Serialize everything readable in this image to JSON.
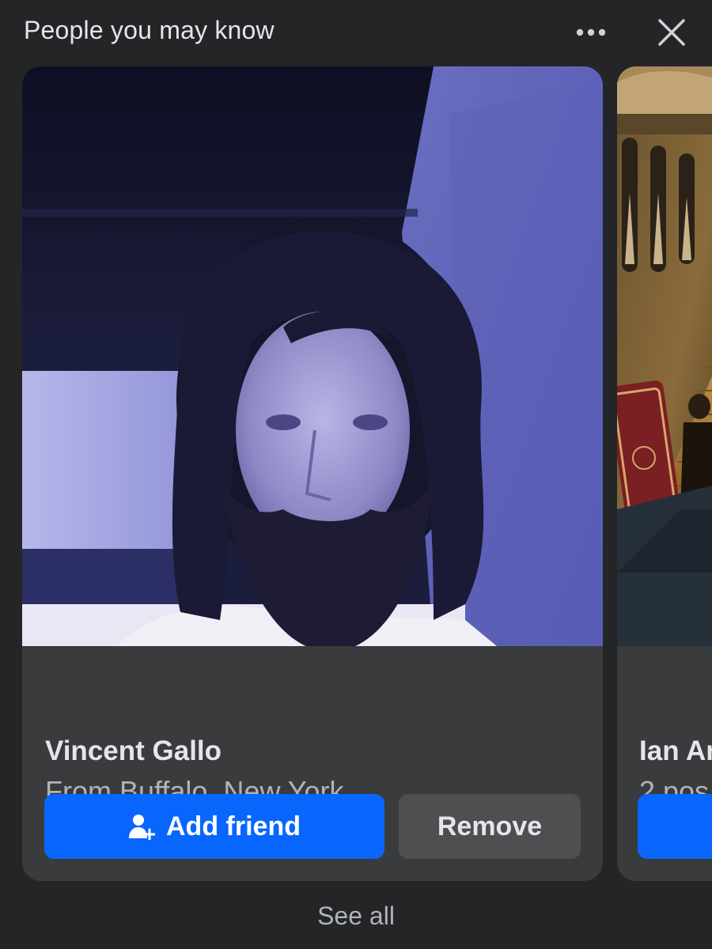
{
  "header": {
    "title": "People you may know",
    "more_icon": "more-horizontal-icon",
    "close_icon": "close-icon"
  },
  "suggestions": [
    {
      "name": "Vincent Gallo",
      "subtitle": "From Buffalo, New York",
      "photo": "profile-photo-bearded-man",
      "add_label": "Add friend",
      "add_icon": "add-friend-icon",
      "remove_label": "Remove"
    },
    {
      "name": "Ian Ar",
      "subtitle": "2 pos",
      "photo": "profile-photo-painting-interior"
    }
  ],
  "footer": {
    "see_all_label": "See all"
  },
  "colors": {
    "background": "#242526",
    "card": "#3a3b3c",
    "primary_button": "#0866ff",
    "secondary_button": "#4e4f50",
    "text_primary": "#e4e6eb",
    "text_secondary": "#b0b3b8"
  }
}
